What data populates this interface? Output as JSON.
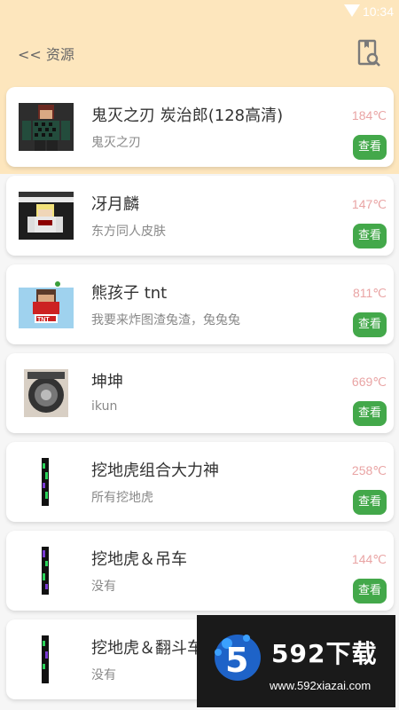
{
  "status_bar": {
    "time": "10:34"
  },
  "header": {
    "back_label": "<< 资源"
  },
  "resources": [
    {
      "title": "鬼灭之刃 炭治郎(128高清)",
      "subtitle": "鬼灭之刃",
      "temp": "184℃",
      "action": "查看"
    },
    {
      "title": "冴月麟",
      "subtitle": "东方同人皮肤",
      "temp": "147℃",
      "action": "查看"
    },
    {
      "title": "熊孩子 tnt",
      "subtitle": "我要来炸图渣兔渣，兔兔兔",
      "temp": "811℃",
      "action": "查看"
    },
    {
      "title": "坤坤",
      "subtitle": "ikun",
      "temp": "669℃",
      "action": "查看"
    },
    {
      "title": "挖地虎组合大力神",
      "subtitle": "所有挖地虎",
      "temp": "258℃",
      "action": "查看"
    },
    {
      "title": "挖地虎＆吊车",
      "subtitle": "没有",
      "temp": "144℃",
      "action": "查看"
    },
    {
      "title": "挖地虎＆翻斗车",
      "subtitle": "没有",
      "temp": "",
      "action": ""
    }
  ],
  "watermark": {
    "brand": "592下载",
    "url": "www.592xiazai.com"
  }
}
